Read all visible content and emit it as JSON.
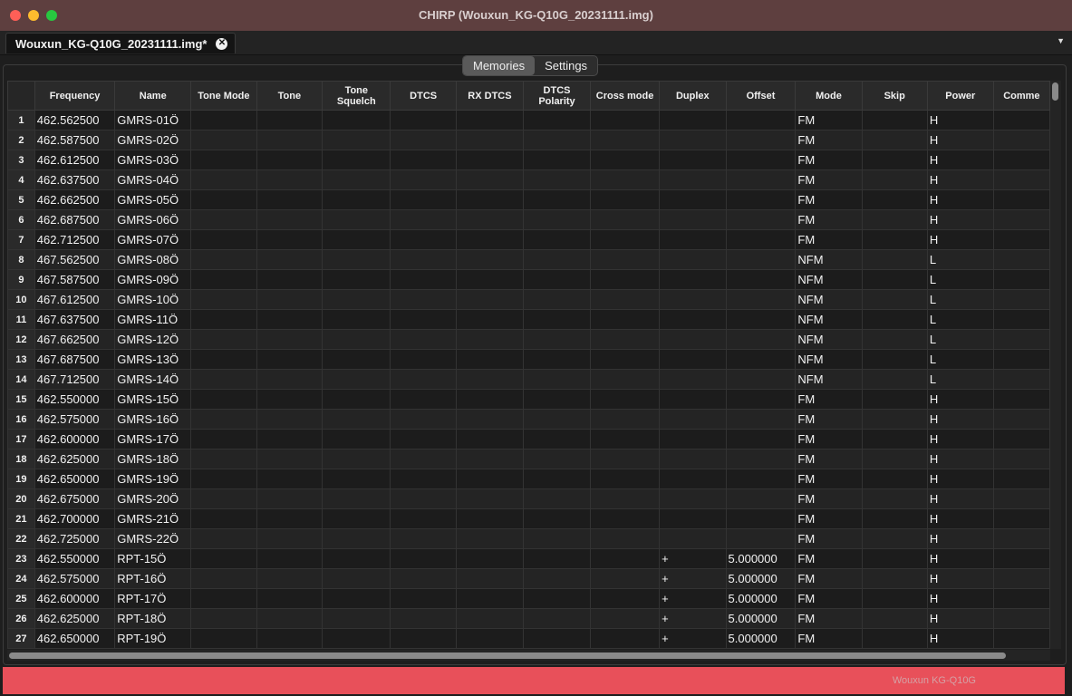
{
  "window": {
    "title": "CHIRP (Wouxun_KG-Q10G_20231111.img)"
  },
  "file_tab": {
    "label": "Wouxun_KG-Q10G_20231111.img*"
  },
  "view_tabs": [
    {
      "label": "Memories",
      "active": true
    },
    {
      "label": "Settings",
      "active": false
    }
  ],
  "columns": [
    {
      "label": "Frequency",
      "width": 86
    },
    {
      "label": "Name",
      "width": 81
    },
    {
      "label": "Tone Mode",
      "width": 74
    },
    {
      "label": "Tone",
      "width": 75
    },
    {
      "label": "Tone Squelch",
      "width": 75
    },
    {
      "label": "DTCS",
      "width": 74
    },
    {
      "label": "RX DTCS",
      "width": 76
    },
    {
      "label": "DTCS Polarity",
      "width": 74
    },
    {
      "label": "Cross mode",
      "width": 78
    },
    {
      "label": "Duplex",
      "width": 74
    },
    {
      "label": "Offset",
      "width": 75
    },
    {
      "label": "Mode",
      "width": 75
    },
    {
      "label": "Skip",
      "width": 75
    },
    {
      "label": "Power",
      "width": 74
    },
    {
      "label": "Comme",
      "width": 60
    }
  ],
  "rows": [
    {
      "n": "1",
      "freq": "462.562500",
      "name": "GMRS-01Ö",
      "duplex": "",
      "offset": "",
      "mode": "FM",
      "power": "H"
    },
    {
      "n": "2",
      "freq": "462.587500",
      "name": "GMRS-02Ö",
      "duplex": "",
      "offset": "",
      "mode": "FM",
      "power": "H"
    },
    {
      "n": "3",
      "freq": "462.612500",
      "name": "GMRS-03Ö",
      "duplex": "",
      "offset": "",
      "mode": "FM",
      "power": "H"
    },
    {
      "n": "4",
      "freq": "462.637500",
      "name": "GMRS-04Ö",
      "duplex": "",
      "offset": "",
      "mode": "FM",
      "power": "H"
    },
    {
      "n": "5",
      "freq": "462.662500",
      "name": "GMRS-05Ö",
      "duplex": "",
      "offset": "",
      "mode": "FM",
      "power": "H"
    },
    {
      "n": "6",
      "freq": "462.687500",
      "name": "GMRS-06Ö",
      "duplex": "",
      "offset": "",
      "mode": "FM",
      "power": "H"
    },
    {
      "n": "7",
      "freq": "462.712500",
      "name": "GMRS-07Ö",
      "duplex": "",
      "offset": "",
      "mode": "FM",
      "power": "H"
    },
    {
      "n": "8",
      "freq": "467.562500",
      "name": "GMRS-08Ö",
      "duplex": "",
      "offset": "",
      "mode": "NFM",
      "power": "L"
    },
    {
      "n": "9",
      "freq": "467.587500",
      "name": "GMRS-09Ö",
      "duplex": "",
      "offset": "",
      "mode": "NFM",
      "power": "L"
    },
    {
      "n": "10",
      "freq": "467.612500",
      "name": "GMRS-10Ö",
      "duplex": "",
      "offset": "",
      "mode": "NFM",
      "power": "L"
    },
    {
      "n": "11",
      "freq": "467.637500",
      "name": "GMRS-11Ö",
      "duplex": "",
      "offset": "",
      "mode": "NFM",
      "power": "L"
    },
    {
      "n": "12",
      "freq": "467.662500",
      "name": "GMRS-12Ö",
      "duplex": "",
      "offset": "",
      "mode": "NFM",
      "power": "L"
    },
    {
      "n": "13",
      "freq": "467.687500",
      "name": "GMRS-13Ö",
      "duplex": "",
      "offset": "",
      "mode": "NFM",
      "power": "L"
    },
    {
      "n": "14",
      "freq": "467.712500",
      "name": "GMRS-14Ö",
      "duplex": "",
      "offset": "",
      "mode": "NFM",
      "power": "L"
    },
    {
      "n": "15",
      "freq": "462.550000",
      "name": "GMRS-15Ö",
      "duplex": "",
      "offset": "",
      "mode": "FM",
      "power": "H"
    },
    {
      "n": "16",
      "freq": "462.575000",
      "name": "GMRS-16Ö",
      "duplex": "",
      "offset": "",
      "mode": "FM",
      "power": "H"
    },
    {
      "n": "17",
      "freq": "462.600000",
      "name": "GMRS-17Ö",
      "duplex": "",
      "offset": "",
      "mode": "FM",
      "power": "H"
    },
    {
      "n": "18",
      "freq": "462.625000",
      "name": "GMRS-18Ö",
      "duplex": "",
      "offset": "",
      "mode": "FM",
      "power": "H"
    },
    {
      "n": "19",
      "freq": "462.650000",
      "name": "GMRS-19Ö",
      "duplex": "",
      "offset": "",
      "mode": "FM",
      "power": "H"
    },
    {
      "n": "20",
      "freq": "462.675000",
      "name": "GMRS-20Ö",
      "duplex": "",
      "offset": "",
      "mode": "FM",
      "power": "H"
    },
    {
      "n": "21",
      "freq": "462.700000",
      "name": "GMRS-21Ö",
      "duplex": "",
      "offset": "",
      "mode": "FM",
      "power": "H"
    },
    {
      "n": "22",
      "freq": "462.725000",
      "name": "GMRS-22Ö",
      "duplex": "",
      "offset": "",
      "mode": "FM",
      "power": "H"
    },
    {
      "n": "23",
      "freq": "462.550000",
      "name": "RPT-15Ö",
      "duplex": "+",
      "offset": "5.000000",
      "mode": "FM",
      "power": "H"
    },
    {
      "n": "24",
      "freq": "462.575000",
      "name": "RPT-16Ö",
      "duplex": "+",
      "offset": "5.000000",
      "mode": "FM",
      "power": "H"
    },
    {
      "n": "25",
      "freq": "462.600000",
      "name": "RPT-17Ö",
      "duplex": "+",
      "offset": "5.000000",
      "mode": "FM",
      "power": "H"
    },
    {
      "n": "26",
      "freq": "462.625000",
      "name": "RPT-18Ö",
      "duplex": "+",
      "offset": "5.000000",
      "mode": "FM",
      "power": "H"
    },
    {
      "n": "27",
      "freq": "462.650000",
      "name": "RPT-19Ö",
      "duplex": "+",
      "offset": "5.000000",
      "mode": "FM",
      "power": "H"
    }
  ],
  "status": {
    "radio_model": "Wouxun KG-Q10G"
  },
  "colors": {
    "titlebar": "#5e3f3f",
    "statusbar": "#e8505a"
  }
}
